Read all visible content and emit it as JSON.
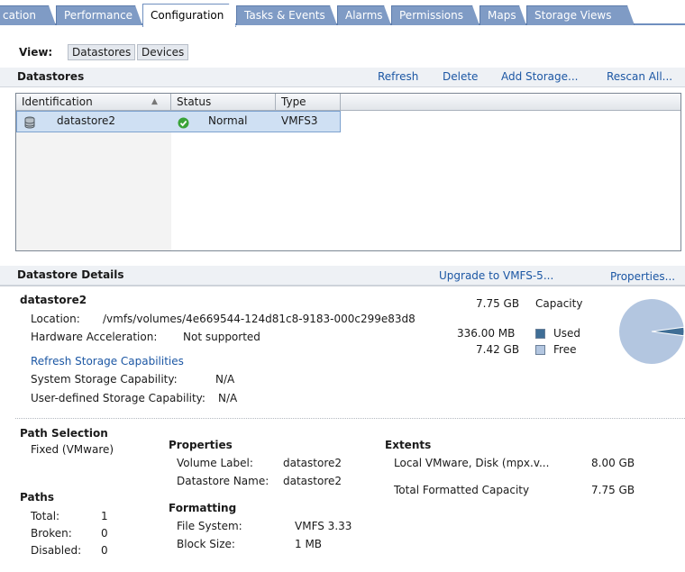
{
  "tabs": [
    {
      "label": "cation"
    },
    {
      "label": "Performance"
    },
    {
      "label": "Configuration"
    },
    {
      "label": "Tasks & Events"
    },
    {
      "label": "Alarms"
    },
    {
      "label": "Permissions"
    },
    {
      "label": "Maps"
    },
    {
      "label": "Storage Views"
    }
  ],
  "view": {
    "label": "View:",
    "options": [
      {
        "label": "Datastores"
      },
      {
        "label": "Devices"
      }
    ]
  },
  "datastores": {
    "title": "Datastores",
    "actions": {
      "refresh": "Refresh",
      "delete": "Delete",
      "add": "Add Storage...",
      "rescan": "Rescan All..."
    },
    "columns": {
      "identification": "Identification",
      "status": "Status",
      "type": "Type"
    },
    "rows": [
      {
        "name": "datastore2",
        "status": "Normal",
        "type": "VMFS3"
      }
    ]
  },
  "details": {
    "title": "Datastore Details",
    "upgrade": "Upgrade to VMFS-5...",
    "properties_link": "Properties...",
    "name": "datastore2",
    "location_label": "Location:",
    "location": "/vmfs/volumes/4e669544-124d81c8-9183-000c299e83d8",
    "hw_accel_label": "Hardware Acceleration:",
    "hw_accel": "Not supported",
    "refresh_caps": "Refresh Storage Capabilities",
    "sys_cap_label": "System Storage Capability:",
    "sys_cap": "N/A",
    "user_cap_label": "User-defined Storage Capability:",
    "user_cap": "N/A",
    "capacity": {
      "value": "7.75 GB",
      "label": "Capacity"
    },
    "used": {
      "value": "336.00 MB",
      "label": "Used",
      "fraction": 0.0423,
      "color": "#3f6e96"
    },
    "free": {
      "value": "7.42 GB",
      "label": "Free",
      "fraction": 0.9577,
      "color": "#b3c6e0"
    }
  },
  "path_selection": {
    "title": "Path Selection",
    "value": "Fixed (VMware)"
  },
  "paths": {
    "title": "Paths",
    "total_label": "Total:",
    "total": "1",
    "broken_label": "Broken:",
    "broken": "0",
    "disabled_label": "Disabled:",
    "disabled": "0"
  },
  "properties": {
    "title": "Properties",
    "volume_label_label": "Volume Label:",
    "volume_label": "datastore2",
    "ds_name_label": "Datastore Name:",
    "ds_name": "datastore2"
  },
  "formatting": {
    "title": "Formatting",
    "fs_label": "File System:",
    "fs": "VMFS 3.33",
    "block_label": "Block Size:",
    "block": "1 MB"
  },
  "extents": {
    "title": "Extents",
    "disk_label": "Local VMware, Disk (mpx.v...",
    "disk_size": "8.00 GB",
    "total_label": "Total Formatted Capacity",
    "total_size": "7.75 GB"
  },
  "colors": {
    "accent": "#7f9bc5",
    "link": "#1c57a4",
    "status_ok": "#3aa339"
  }
}
